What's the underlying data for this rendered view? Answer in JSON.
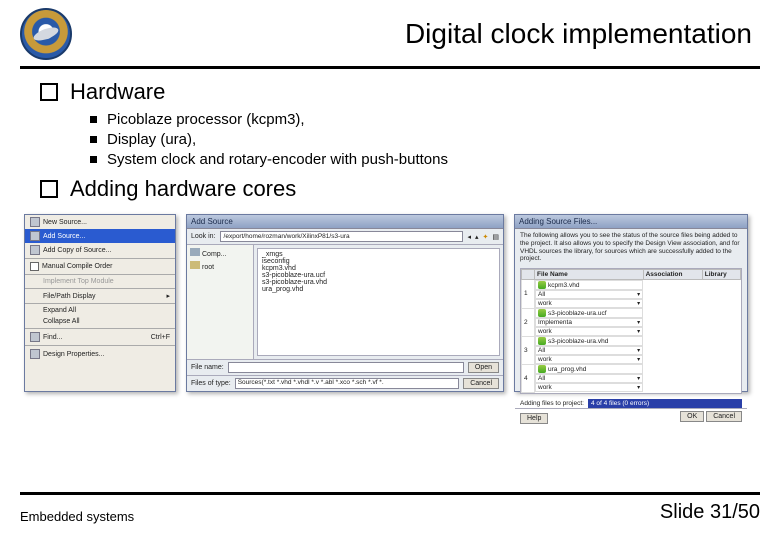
{
  "slide": {
    "title": "Digital clock implementation",
    "footer_left": "Embedded systems",
    "footer_right": "Slide 31/50"
  },
  "bullets": {
    "b1": "Hardware",
    "b1_subs": [
      "Picoblaze processor (kcpm3),",
      "Display (ura),",
      "System clock and rotary-encoder with push-buttons"
    ],
    "b2": "Adding hardware cores"
  },
  "win1": {
    "items": {
      "new": "New Source...",
      "add": "Add Source...",
      "addcopy": "Add Copy of Source...",
      "manual": "Manual Compile Order",
      "top": "Implement Top Module",
      "proc": "File/Path Display",
      "expand": "Expand All",
      "collapse": "Collapse All",
      "find": "Find...",
      "find_hk": "Ctrl+F",
      "design": "Design Properties..."
    }
  },
  "win2": {
    "title": "Add Source",
    "lookin": "Look in:",
    "path": "/export/home/rozman/work/XilinxP81/s3-ura",
    "side": {
      "comp": "Comp...",
      "root": "root"
    },
    "files": [
      "_xmgs",
      "iseconfig",
      "kcpm3.vhd",
      "s3-picoblaze-ura.ucf",
      "s3-picoblaze-ura.vhd",
      "ura_prog.vhd"
    ],
    "fname_lbl": "File name:",
    "ftype_lbl": "Files of type:",
    "ftype_val": "Sources(*.txt *.vhd *.vhdl *.v *.abl *.xco *.sch *.vf *.",
    "open": "Open",
    "cancel": "Cancel"
  },
  "win3": {
    "title": "Adding Source Files...",
    "desc": "The following allows you to see the status of the source files being added to the project. It also allows you to specify the Design View association, and for VHDL sources the library, for sources which are successfully added to the project.",
    "headers": {
      "file": "File Name",
      "assoc": "Association",
      "lib": "Library"
    },
    "rows": [
      {
        "file": "kcpm3.vhd",
        "assoc": "All",
        "lib": "work"
      },
      {
        "file": "s3-picoblaze-ura.ucf",
        "assoc": "Implementa",
        "lib": "work"
      },
      {
        "file": "s3-picoblaze-ura.vhd",
        "assoc": "All",
        "lib": "work"
      },
      {
        "file": "ura_prog.vhd",
        "assoc": "All",
        "lib": "work"
      }
    ],
    "status_lbl": "Adding files to project:",
    "status_val": "4 of 4 files (0 errors)",
    "help": "Help",
    "ok": "OK",
    "cancel": "Cancel"
  }
}
